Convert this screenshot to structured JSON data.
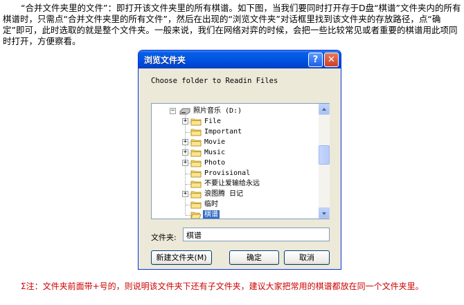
{
  "paragraph": "“合并文件夹里的文件”：即打开该文件夹里的所有棋谱。如下图，当我们要同时打开存于D盘“棋谱”文件夹内的所有棋谱时，只需点“合并文件夹里的所有文件”，然后在出现的“浏览文件夹”对话框里找到该文件夹的存放路径，点“确定”即可，此时选取的就是整个文件夹。一般来说，我们在网络对弈的时候，会把一些比较常见或者重要的棋谱用此项同时打开，方便察看。",
  "dialog": {
    "title": "浏览文件夹",
    "help_glyph": "?",
    "close_glyph": "✕",
    "prompt": "Choose folder to Readin Files",
    "tree": {
      "drive": "照片音乐 (D:)",
      "folders": [
        {
          "label": "File",
          "expandable": true
        },
        {
          "label": "Important",
          "expandable": false
        },
        {
          "label": "Movie",
          "expandable": true
        },
        {
          "label": "Music",
          "expandable": true
        },
        {
          "label": "Photo",
          "expandable": true
        },
        {
          "label": "Provisional",
          "expandable": false
        },
        {
          "label": "不要让爱输给永远",
          "expandable": false
        },
        {
          "label": "浪图腾 日记",
          "expandable": true
        },
        {
          "label": "临时",
          "expandable": false
        },
        {
          "label": "棋谱",
          "expandable": false,
          "selected": true
        }
      ]
    },
    "folder_field_label": "文件夹:",
    "folder_field_value": "棋谱",
    "buttons": {
      "new_folder": "新建文件夹(M)",
      "ok": "确定",
      "cancel": "取消"
    }
  },
  "note": "Σ注：文件夹前面带+号的，则说明该文件夹下还有子文件夹，建议大家把常用的棋谱都放在同一个文件夹里。",
  "colors": {
    "note_text": "#cc0000",
    "selection": "#316ac5",
    "titlebar": "#0054e3"
  }
}
